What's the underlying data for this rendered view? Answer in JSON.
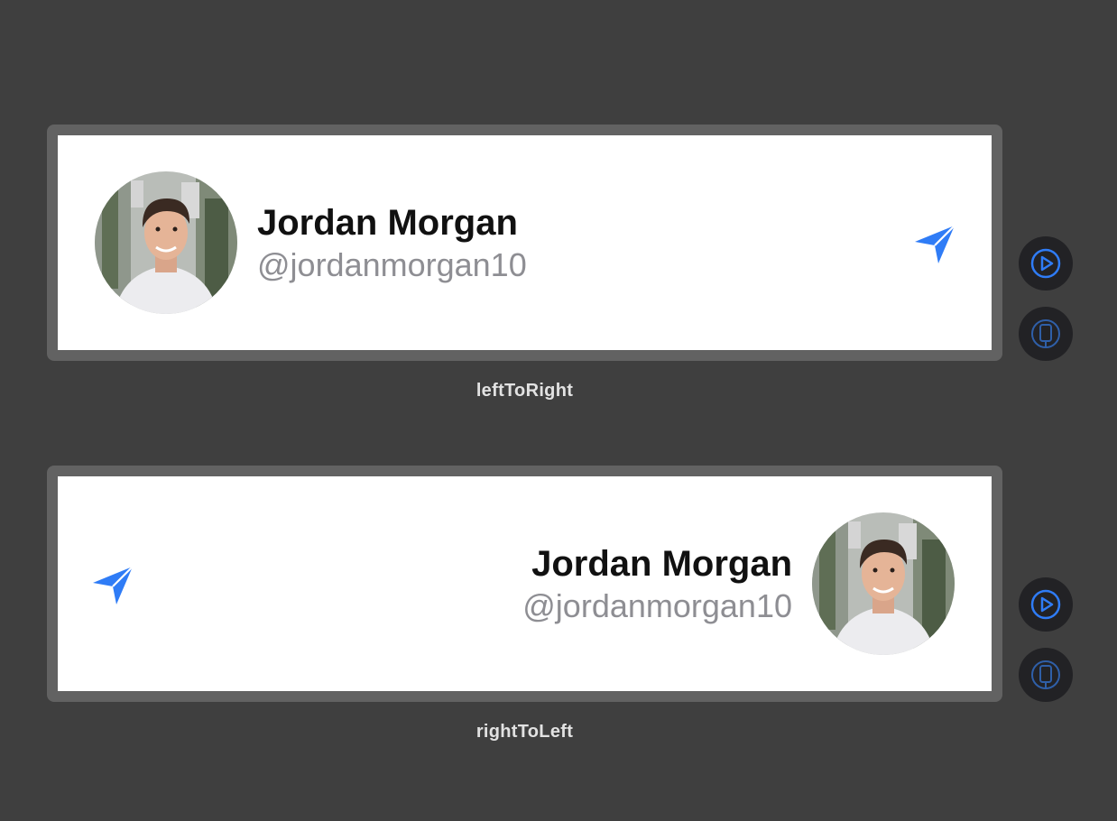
{
  "previews": [
    {
      "name": "Jordan Morgan",
      "handle": "@jordanmorgan10",
      "label": "leftToRight",
      "layout_direction": "left-to-right"
    },
    {
      "name": "Jordan Morgan",
      "handle": "@jordanmorgan10",
      "label": "rightToLeft",
      "layout_direction": "right-to-left"
    }
  ],
  "icons": {
    "send": "paperplane-fill-icon",
    "live_preview": "play-circle-icon",
    "device_preview": "device-icon"
  },
  "colors": {
    "background": "#3f3f3f",
    "frame": "#626262",
    "card": "#ffffff",
    "name_text": "#111111",
    "handle_text": "#8e8e93",
    "accent_blue": "#2f7cf6",
    "button_bg": "#222225"
  }
}
